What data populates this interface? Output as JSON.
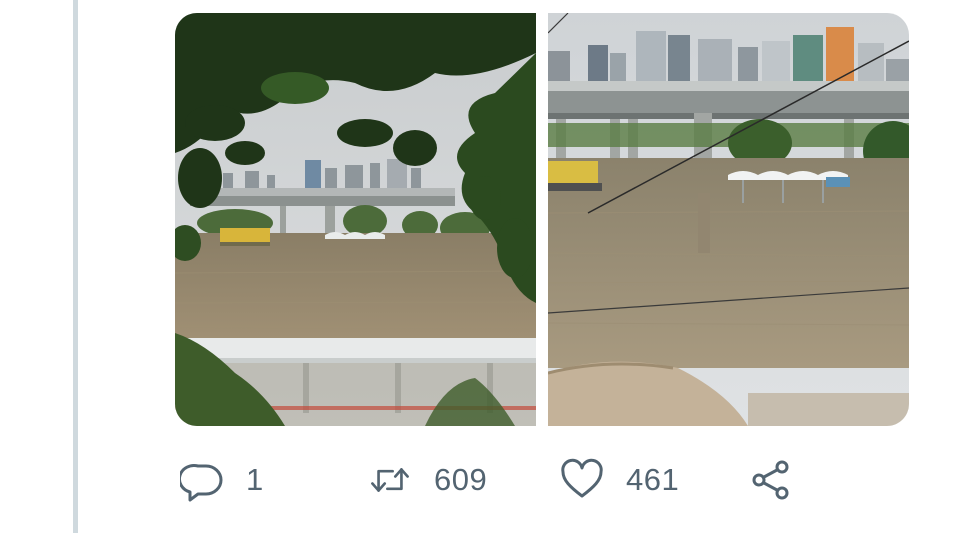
{
  "tweet": {
    "media": [
      {
        "name": "flooded-park-through-trees"
      },
      {
        "name": "flooded-riverbank-under-bridge"
      }
    ],
    "actions": {
      "reply_count": "1",
      "retweet_count": "609",
      "like_count": "461"
    },
    "icons": {
      "reply": "speech-bubble-icon",
      "retweet": "retweet-arrows-icon",
      "like": "heart-icon",
      "share": "share-icon"
    }
  }
}
